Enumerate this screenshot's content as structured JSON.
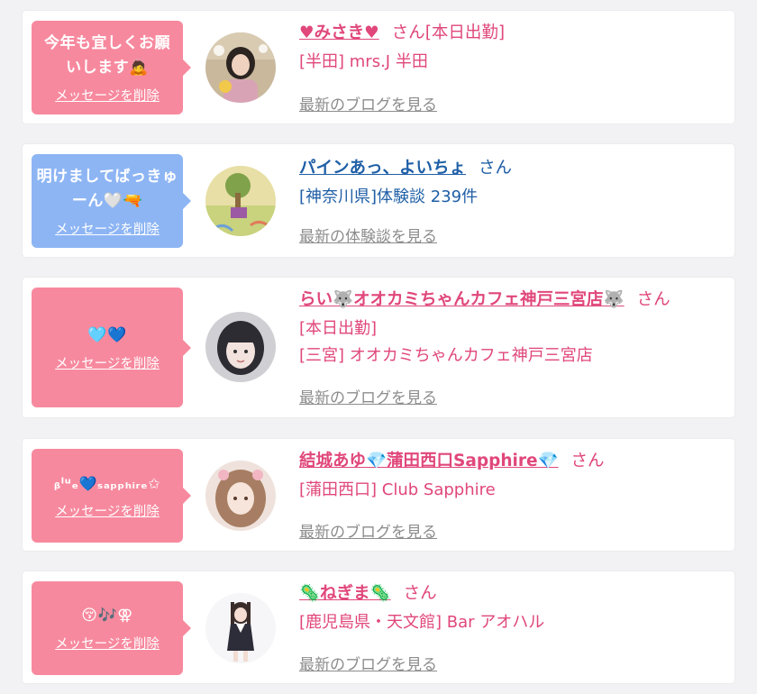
{
  "items": [
    {
      "message": "今年も宜しくお願いします🙇",
      "delete_label": "メッセージを削除",
      "name": "♥みさき♥",
      "honorific": "さん",
      "status": "[本日出勤]",
      "shop": "[半田] mrs.J 半田",
      "link": "最新のブログを見る",
      "color": "#f7899e"
    },
    {
      "message": "明けましてばっきゅーん🤍🔫",
      "delete_label": "メッセージを削除",
      "name": "パインあっ、よいちょ",
      "honorific": "さん",
      "shop": "[神奈川県]体験談 239件",
      "link": "最新の体験談を見る",
      "color": "#8db5f4"
    },
    {
      "message": "🩵💙",
      "delete_label": "メッセージを削除",
      "name": "らい🐺オオカミちゃんカフェ神戸三宮店🐺",
      "honorific": "さん",
      "status": "[本日出勤]",
      "shop": "[三宮] オオカミちゃんカフェ神戸三宮店",
      "link": "最新のブログを見る",
      "color": "#f7899e"
    },
    {
      "message": "ᵦˡᵘₑ💙ₛₐₚₚₕᵢᵣₑ✩",
      "delete_label": "メッセージを削除",
      "name": "結城あゆ💎蒲田西口Sapphire💎",
      "honorific": "さん",
      "shop": "[蒲田西口] Club Sapphire",
      "link": "最新のブログを見る",
      "color": "#f7899e"
    },
    {
      "message": "😚🎶⚢",
      "delete_label": "メッセージを削除",
      "name": "🦠ねぎま🦠",
      "honorific": "さん",
      "shop": "[鹿児島県・天文館] Bar アオハル",
      "link": "最新のブログを見る",
      "color": "#f7899e"
    }
  ]
}
